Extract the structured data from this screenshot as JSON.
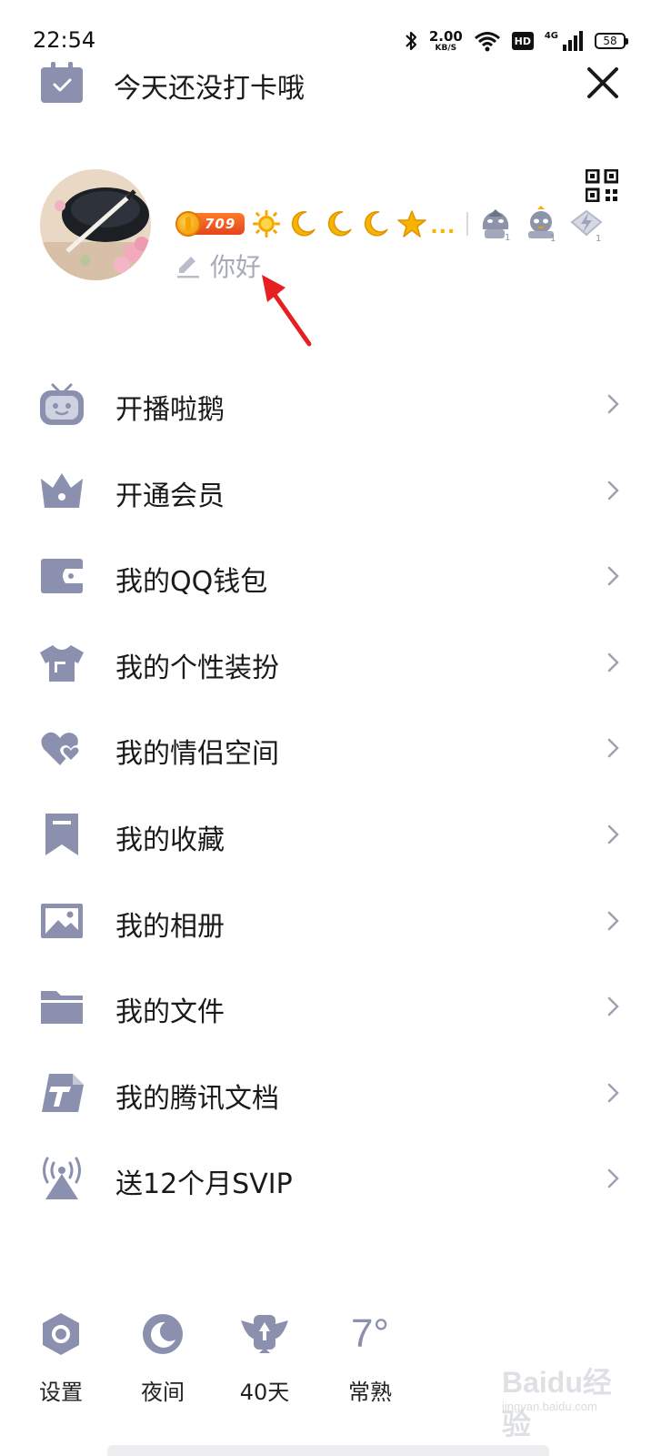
{
  "status_bar": {
    "time": "22:54",
    "net_speed": "2.00",
    "net_speed_unit": "KB/S",
    "hd": "HD",
    "network": "4G",
    "battery": "58"
  },
  "header": {
    "checkin_text": "今天还没打卡哦"
  },
  "profile": {
    "coins": "709",
    "level_icons": [
      "sun-icon",
      "moon-icon",
      "moon-icon",
      "moon-icon",
      "star-icon"
    ],
    "more": "...",
    "signature": "你好"
  },
  "menu": {
    "items": [
      {
        "label": "开播啦鹅",
        "icon": "tv-robot-icon"
      },
      {
        "label": "开通会员",
        "icon": "crown-icon"
      },
      {
        "label": "我的QQ钱包",
        "icon": "wallet-icon"
      },
      {
        "label": "我的个性装扮",
        "icon": "tshirt-icon"
      },
      {
        "label": "我的情侣空间",
        "icon": "hearts-icon"
      },
      {
        "label": "我的收藏",
        "icon": "bookmark-icon"
      },
      {
        "label": "我的相册",
        "icon": "photo-icon"
      },
      {
        "label": "我的文件",
        "icon": "folder-icon"
      },
      {
        "label": "我的腾讯文档",
        "icon": "tencent-docs-icon"
      },
      {
        "label": "送12个月SVIP",
        "icon": "broadcast-icon"
      }
    ]
  },
  "bottom_bar": {
    "settings": "设置",
    "night": "夜间",
    "days": "40天",
    "temperature": "7°",
    "city": "常熟"
  },
  "watermark": {
    "brand": "Baidu经验",
    "url": "jingyan.baidu.com"
  },
  "colors": {
    "icon_gray": "#8a90ad",
    "arrow_red": "#e62020",
    "coin_orange": "#f07a22"
  }
}
